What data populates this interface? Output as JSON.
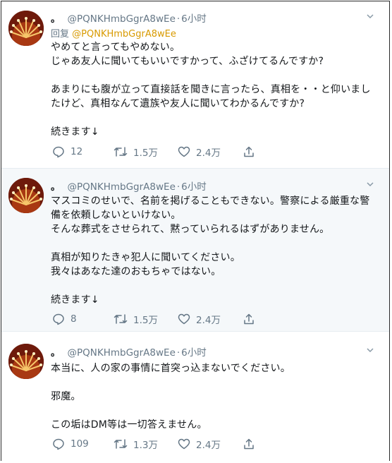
{
  "tweets": [
    {
      "author": "。",
      "handle": "@PQNKHmbGgrA8wEe",
      "separator": "·",
      "time": "6小时",
      "reply_label": "回复",
      "reply_mention": "@PQNKHmbGgrA8wEe",
      "lines": [
        "やめてと言ってもやめない。",
        "じゃあ友人に聞いてもいいですかって、ふざけてるんですか?",
        "",
        "あまりにも腹が立って直接話を聞きに言ったら、真相を・・と仰いまし",
        "たけど、真相なんて遺族や友人に聞いてわかるんですか?",
        "",
        "続きます↓"
      ],
      "replies": "12",
      "retweets": "1.5万",
      "likes": "2.4万"
    },
    {
      "author": "。",
      "handle": "@PQNKHmbGgrA8wEe",
      "separator": "·",
      "time": "6小时",
      "lines": [
        "マスコミのせいで、名前を掲げることもできない。警察による厳重な警",
        "備を依頼しないといけない。",
        "そんな葬式をさせられて、黙っていられるはずがありません。",
        "",
        "真相が知りたきゃ犯人に聞いてください。",
        "我々はあなた達のおもちゃではない。",
        "",
        "続きます↓"
      ],
      "replies": "8",
      "retweets": "1.5万",
      "likes": "2.4万"
    },
    {
      "author": "。",
      "handle": "@PQNKHmbGgrA8wEe",
      "separator": "·",
      "time": "6小时",
      "lines": [
        "本当に、人の家の事情に首突っ込まないでください。",
        "",
        "邪魔。",
        "",
        "この垢はDM等は一切答えません。"
      ],
      "replies": "109",
      "retweets": "1.3万",
      "likes": "2.4万"
    }
  ],
  "icons": {
    "reply": "reply-icon",
    "retweet": "retweet-icon",
    "like": "heart-icon",
    "share": "share-icon",
    "more": "chevron-down-icon"
  },
  "colors": {
    "mention": "#d89a00",
    "secondary_text": "#657786",
    "alt_background": "#f5f8fa"
  }
}
